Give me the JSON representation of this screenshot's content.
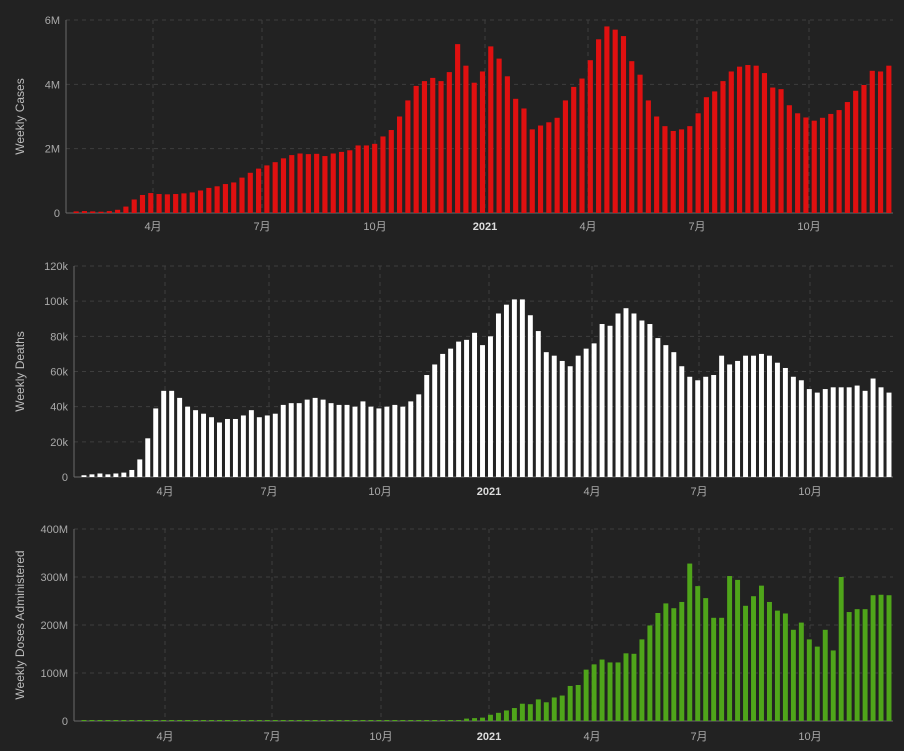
{
  "chart_data": [
    {
      "type": "bar",
      "ylabel": "Weekly Cases",
      "ylim": [
        0,
        6000000
      ],
      "yticks": [
        0,
        2000000,
        4000000,
        6000000
      ],
      "ytick_labels": [
        "0",
        "2M",
        "4M",
        "6M"
      ],
      "xtick_labels": [
        "4月",
        "7月",
        "10月",
        "2021",
        "4月",
        "7月",
        "10月"
      ],
      "color": "#e01010",
      "grid": true,
      "values": [
        50000,
        60000,
        50000,
        40000,
        60000,
        100000,
        200000,
        420000,
        560000,
        620000,
        590000,
        580000,
        590000,
        610000,
        640000,
        700000,
        780000,
        830000,
        900000,
        950000,
        1100000,
        1250000,
        1380000,
        1480000,
        1580000,
        1700000,
        1800000,
        1850000,
        1830000,
        1840000,
        1770000,
        1850000,
        1900000,
        1950000,
        2100000,
        2100000,
        2150000,
        2380000,
        2580000,
        3000000,
        3500000,
        3950000,
        4100000,
        4200000,
        4100000,
        4380000,
        5250000,
        4580000,
        4050000,
        4400000,
        5180000,
        4800000,
        4250000,
        3550000,
        3250000,
        2600000,
        2720000,
        2820000,
        2960000,
        3500000,
        3920000,
        4180000,
        4750000,
        5400000,
        5800000,
        5700000,
        5500000,
        4720000,
        4300000,
        3500000,
        3000000,
        2700000,
        2550000,
        2600000,
        2700000,
        3100000,
        3600000,
        3780000,
        4100000,
        4400000,
        4550000,
        4600000,
        4580000,
        4350000,
        3900000,
        3850000,
        3350000,
        3100000,
        2970000,
        2870000,
        2960000,
        3080000,
        3200000,
        3450000,
        3800000,
        3980000,
        4420000,
        4400000,
        4580000
      ]
    },
    {
      "type": "bar",
      "ylabel": "Weekly Deaths",
      "ylim": [
        0,
        120000
      ],
      "yticks": [
        0,
        20000,
        40000,
        60000,
        80000,
        100000,
        120000
      ],
      "ytick_labels": [
        "0",
        "20k",
        "40k",
        "60k",
        "80k",
        "100k",
        "120k"
      ],
      "xtick_labels": [
        "4月",
        "7月",
        "10月",
        "2021",
        "4月",
        "7月",
        "10月"
      ],
      "color": "#ffffff",
      "grid": true,
      "values": [
        1000,
        1500,
        2000,
        1500,
        2000,
        2500,
        4000,
        10000,
        22000,
        39000,
        49000,
        49000,
        45000,
        40000,
        38000,
        36000,
        34000,
        31000,
        33000,
        33000,
        35000,
        38000,
        34000,
        35000,
        36000,
        41000,
        42000,
        42000,
        44000,
        45000,
        44000,
        42000,
        41000,
        41000,
        40000,
        43000,
        40000,
        39000,
        40000,
        41000,
        40000,
        43000,
        47000,
        58000,
        64000,
        70000,
        73000,
        77000,
        78000,
        82000,
        75000,
        80000,
        93000,
        98000,
        101000,
        101000,
        92000,
        83000,
        71000,
        69000,
        66000,
        63000,
        69000,
        73000,
        76000,
        87000,
        86000,
        93000,
        96000,
        93000,
        89000,
        87000,
        79000,
        75000,
        71000,
        63000,
        57000,
        55000,
        57000,
        58000,
        69000,
        64000,
        66000,
        69000,
        69000,
        70000,
        69000,
        65000,
        62000,
        57000,
        55000,
        50000,
        48000,
        50000,
        51000,
        51000,
        51000,
        52000,
        49000,
        56000,
        51000,
        48000
      ]
    },
    {
      "type": "bar",
      "ylabel": "Weekly Doses Administered",
      "ylim": [
        0,
        400000000
      ],
      "yticks": [
        0,
        100000000,
        200000000,
        300000000,
        400000000
      ],
      "ytick_labels": [
        "0",
        "100M",
        "200M",
        "300M",
        "400M"
      ],
      "xtick_labels": [
        "4月",
        "7月",
        "10月",
        "2021",
        "4月",
        "7月",
        "10月"
      ],
      "color": "#4fa51a",
      "grid": true,
      "values": [
        2000000,
        2000000,
        2000000,
        2000000,
        2000000,
        2000000,
        2000000,
        2000000,
        2000000,
        2000000,
        2000000,
        2000000,
        2000000,
        2000000,
        2000000,
        2000000,
        2000000,
        2000000,
        2000000,
        2000000,
        2000000,
        2000000,
        2000000,
        2000000,
        2000000,
        2000000,
        2000000,
        2000000,
        2000000,
        2000000,
        2000000,
        2000000,
        2000000,
        2000000,
        2000000,
        2000000,
        2000000,
        2000000,
        2000000,
        2000000,
        2000000,
        2000000,
        2000000,
        2000000,
        2000000,
        2000000,
        2000000,
        2000000,
        5000000,
        6000000,
        7000000,
        13000000,
        17000000,
        22000000,
        27000000,
        36000000,
        35000000,
        45000000,
        39000000,
        49000000,
        53000000,
        73000000,
        75000000,
        107000000,
        118000000,
        128000000,
        122000000,
        122000000,
        141000000,
        140000000,
        170000000,
        199000000,
        225000000,
        245000000,
        235000000,
        248000000,
        328000000,
        281000000,
        256000000,
        215000000,
        215000000,
        302000000,
        294000000,
        240000000,
        260000000,
        282000000,
        248000000,
        230000000,
        224000000,
        190000000,
        205000000,
        170000000,
        155000000,
        190000000,
        147000000,
        300000000,
        227000000,
        233000000,
        233000000,
        262000000,
        263000000,
        262000000
      ]
    }
  ]
}
